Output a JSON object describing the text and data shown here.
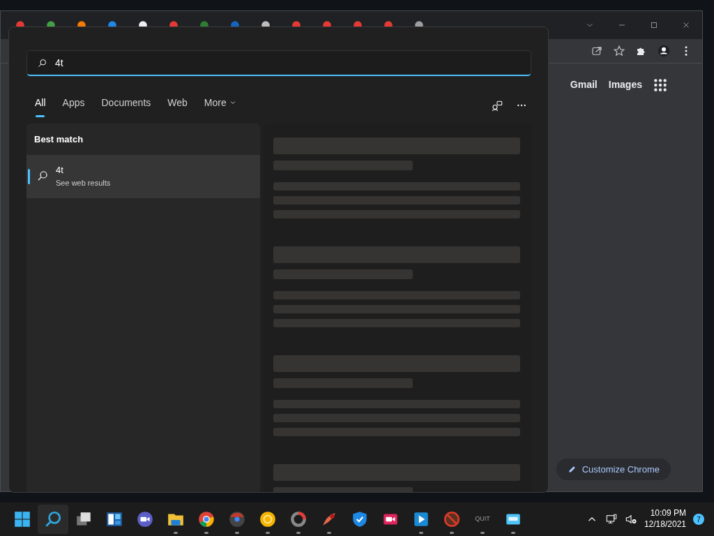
{
  "browser": {
    "header_links": [
      "Gmail",
      "Images"
    ],
    "customize_button": "Customize Chrome"
  },
  "search": {
    "query": "4t",
    "tabs": [
      {
        "label": "All",
        "selected": true
      },
      {
        "label": "Apps",
        "selected": false
      },
      {
        "label": "Documents",
        "selected": false
      },
      {
        "label": "Web",
        "selected": false
      },
      {
        "label": "More",
        "selected": false
      }
    ],
    "best_match": {
      "heading": "Best match",
      "items": [
        {
          "title": "4t",
          "subtitle": "See web results",
          "selected": true
        }
      ]
    }
  },
  "taskbar": {
    "apps": [
      {
        "kind": "start",
        "running": false,
        "selected": false
      },
      {
        "kind": "search",
        "running": false,
        "selected": true
      },
      {
        "kind": "taskview",
        "running": false,
        "selected": false
      },
      {
        "kind": "widgets",
        "running": false,
        "selected": false
      },
      {
        "kind": "chat",
        "running": false,
        "selected": false
      },
      {
        "kind": "explorer",
        "running": true,
        "selected": false
      },
      {
        "kind": "chrome",
        "running": true,
        "selected": false
      },
      {
        "kind": "chromedev",
        "running": true,
        "selected": false
      },
      {
        "kind": "canary",
        "running": true,
        "selected": false
      },
      {
        "kind": "ring",
        "running": true,
        "selected": false
      },
      {
        "kind": "brush",
        "running": true,
        "selected": false
      },
      {
        "kind": "shield",
        "running": false,
        "selected": false
      },
      {
        "kind": "recorder",
        "running": false,
        "selected": false
      },
      {
        "kind": "player",
        "running": true,
        "selected": false
      },
      {
        "kind": "blocked",
        "running": true,
        "selected": false
      },
      {
        "kind": "text",
        "label": "QUIT",
        "running": true,
        "selected": false
      },
      {
        "kind": "screen",
        "running": true,
        "selected": false
      }
    ],
    "time": "10:09 PM",
    "date": "12/18/2021",
    "notifications": "7"
  }
}
